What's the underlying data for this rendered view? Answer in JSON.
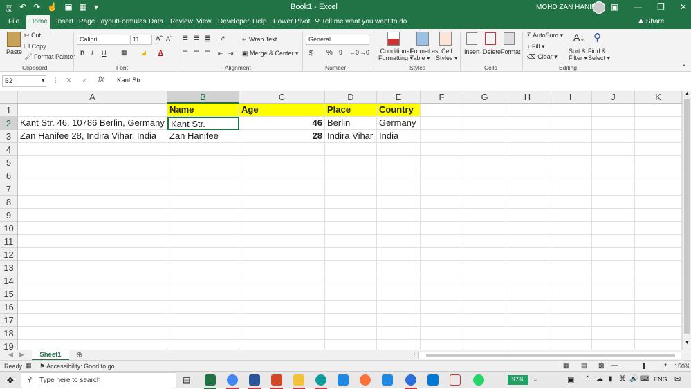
{
  "titlebar": {
    "center_title": "Book1  -  Excel",
    "user_name": "MOHD ZAN HANIFEE"
  },
  "ribbon_tabs": [
    "File",
    "Home",
    "Insert",
    "Page Layout",
    "Formulas",
    "Data",
    "Review",
    "View",
    "Developer",
    "Help",
    "Power Pivot"
  ],
  "tell_me": "Tell me what you want to do",
  "share": "Share",
  "clipboard": {
    "paste": "Paste",
    "cut": "Cut",
    "copy": "Copy",
    "format_painter": "Format Painter",
    "label": "Clipboard"
  },
  "font": {
    "family": "Calibri",
    "size": "11",
    "label": "Font"
  },
  "alignment": {
    "wrap": "Wrap Text",
    "merge": "Merge & Center",
    "label": "Alignment"
  },
  "number": {
    "format": "General",
    "label": "Number"
  },
  "styles": {
    "cond1": "Conditional",
    "cond2": "Formatting",
    "fmt1": "Format as",
    "fmt2": "Table",
    "cell1": "Cell",
    "cell2": "Styles",
    "label": "Styles"
  },
  "cells": {
    "insert": "Insert",
    "delete": "Delete",
    "format": "Format",
    "label": "Cells"
  },
  "editing": {
    "autosum": "AutoSum",
    "fill": "Fill",
    "clear": "Clear",
    "sort1": "Sort &",
    "sort2": "Filter",
    "find1": "Find &",
    "find2": "Select",
    "label": "Editing"
  },
  "formula_bar": {
    "name_box": "B2",
    "fx": "fx",
    "value": "Kant Str."
  },
  "columns": [
    "A",
    "B",
    "C",
    "D",
    "E",
    "F",
    "G",
    "H",
    "I",
    "J",
    "K"
  ],
  "rows": [
    "1",
    "2",
    "3",
    "4",
    "5",
    "6",
    "7",
    "8",
    "9",
    "10",
    "11",
    "12",
    "13",
    "14",
    "15",
    "16",
    "17",
    "18",
    "19"
  ],
  "cells_data": {
    "B1": "Name",
    "C1": "Age",
    "D1": "Place",
    "E1": "Country",
    "A2": "Kant Str. 46, 10786 Berlin, Germany",
    "B2": "Kant Str.",
    "C2": "46",
    "D2": "Berlin",
    "E2": "Germany",
    "A3": "Zan Hanifee 28, Indira Vihar, India",
    "B3": "Zan Hanifee",
    "C3": "28",
    "D3": "Indira Vihar",
    "E3": "India"
  },
  "sheet": {
    "tab": "Sheet1"
  },
  "status": {
    "ready": "Ready",
    "accessibility": "Accessibility: Good to go",
    "zoom": "150%"
  },
  "taskbar": {
    "search": "Type here to search",
    "battery": "97%",
    "lang": "ENG"
  }
}
